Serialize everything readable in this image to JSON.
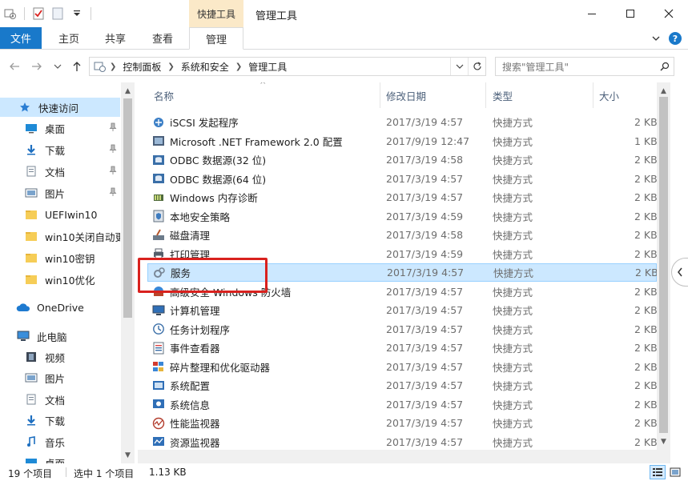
{
  "window": {
    "title": "管理工具",
    "context_tab_group": "快捷工具",
    "accent_color": "#1979ca"
  },
  "ribbon": {
    "tabs": [
      {
        "label": "文件"
      },
      {
        "label": "主页"
      },
      {
        "label": "共享"
      },
      {
        "label": "查看"
      },
      {
        "label": "管理"
      }
    ]
  },
  "address": {
    "crumbs": [
      "控制面板",
      "系统和安全",
      "管理工具"
    ],
    "search_placeholder": "搜索\"管理工具\""
  },
  "nav_pane": {
    "items": [
      {
        "label": "快速访问",
        "icon": "star-icon",
        "pinned": false
      },
      {
        "label": "桌面",
        "icon": "desktop-icon",
        "pinned": true
      },
      {
        "label": "下载",
        "icon": "download-icon",
        "pinned": true
      },
      {
        "label": "文档",
        "icon": "document-icon",
        "pinned": true
      },
      {
        "label": "图片",
        "icon": "picture-icon",
        "pinned": true
      },
      {
        "label": "UEFIwin10",
        "icon": "folder-icon",
        "pinned": false
      },
      {
        "label": "win10关闭自动更",
        "icon": "folder-icon",
        "pinned": false
      },
      {
        "label": "win10密钥",
        "icon": "folder-icon",
        "pinned": false
      },
      {
        "label": "win10优化",
        "icon": "folder-icon",
        "pinned": false
      },
      {
        "label": "OneDrive",
        "icon": "cloud-icon",
        "pinned": false
      },
      {
        "label": "此电脑",
        "icon": "computer-icon",
        "pinned": false
      },
      {
        "label": "视频",
        "icon": "video-icon",
        "pinned": false
      },
      {
        "label": "图片",
        "icon": "picture-icon",
        "pinned": false
      },
      {
        "label": "文档",
        "icon": "document-icon",
        "pinned": false
      },
      {
        "label": "下载",
        "icon": "download-icon",
        "pinned": false
      },
      {
        "label": "音乐",
        "icon": "music-icon",
        "pinned": false
      },
      {
        "label": "桌面",
        "icon": "desktop-icon",
        "pinned": false
      }
    ]
  },
  "file_list": {
    "columns": [
      "名称",
      "修改日期",
      "类型",
      "大小"
    ],
    "rows": [
      {
        "name": "iSCSI 发起程序",
        "date": "2017/3/19 4:57",
        "type": "快捷方式",
        "size": "2 KB",
        "icon": "iscsi-icon"
      },
      {
        "name": "Microsoft .NET Framework 2.0 配置",
        "date": "2017/9/19 12:47",
        "type": "快捷方式",
        "size": "1 KB",
        "icon": "dotnet-icon"
      },
      {
        "name": "ODBC 数据源(32 位)",
        "date": "2017/3/19 4:58",
        "type": "快捷方式",
        "size": "2 KB",
        "icon": "odbc-icon"
      },
      {
        "name": "ODBC 数据源(64 位)",
        "date": "2017/3/19 4:57",
        "type": "快捷方式",
        "size": "2 KB",
        "icon": "odbc-icon"
      },
      {
        "name": "Windows 内存诊断",
        "date": "2017/3/19 4:57",
        "type": "快捷方式",
        "size": "2 KB",
        "icon": "memory-diagnostic-icon"
      },
      {
        "name": "本地安全策略",
        "date": "2017/3/19 4:59",
        "type": "快捷方式",
        "size": "2 KB",
        "icon": "security-policy-icon"
      },
      {
        "name": "磁盘清理",
        "date": "2017/3/19 4:58",
        "type": "快捷方式",
        "size": "2 KB",
        "icon": "disk-cleanup-icon"
      },
      {
        "name": "打印管理",
        "date": "2017/3/19 4:59",
        "type": "快捷方式",
        "size": "2 KB",
        "icon": "print-management-icon"
      },
      {
        "name": "服务",
        "date": "2017/3/19 4:57",
        "type": "快捷方式",
        "size": "2 KB",
        "icon": "services-icon",
        "selected": true
      },
      {
        "name": "高级安全 Windows 防火墙",
        "date": "2017/3/19 4:57",
        "type": "快捷方式",
        "size": "2 KB",
        "icon": "firewall-icon"
      },
      {
        "name": "计算机管理",
        "date": "2017/3/19 4:57",
        "type": "快捷方式",
        "size": "2 KB",
        "icon": "computer-management-icon"
      },
      {
        "name": "任务计划程序",
        "date": "2017/3/19 4:57",
        "type": "快捷方式",
        "size": "2 KB",
        "icon": "task-scheduler-icon"
      },
      {
        "name": "事件查看器",
        "date": "2017/3/19 4:57",
        "type": "快捷方式",
        "size": "2 KB",
        "icon": "event-viewer-icon"
      },
      {
        "name": "碎片整理和优化驱动器",
        "date": "2017/3/19 4:57",
        "type": "快捷方式",
        "size": "2 KB",
        "icon": "defrag-icon"
      },
      {
        "name": "系统配置",
        "date": "2017/3/19 4:57",
        "type": "快捷方式",
        "size": "2 KB",
        "icon": "system-config-icon"
      },
      {
        "name": "系统信息",
        "date": "2017/3/19 4:57",
        "type": "快捷方式",
        "size": "2 KB",
        "icon": "system-info-icon"
      },
      {
        "name": "性能监视器",
        "date": "2017/3/19 4:57",
        "type": "快捷方式",
        "size": "2 KB",
        "icon": "performance-monitor-icon"
      },
      {
        "name": "资源监视器",
        "date": "2017/3/19 4:57",
        "type": "快捷方式",
        "size": "2 KB",
        "icon": "resource-monitor-icon"
      }
    ],
    "highlight_color": "#d9211e"
  },
  "status_bar": {
    "item_count": "19 个项目",
    "selection": "选中 1 个项目",
    "selection_size": "1.13 KB"
  }
}
